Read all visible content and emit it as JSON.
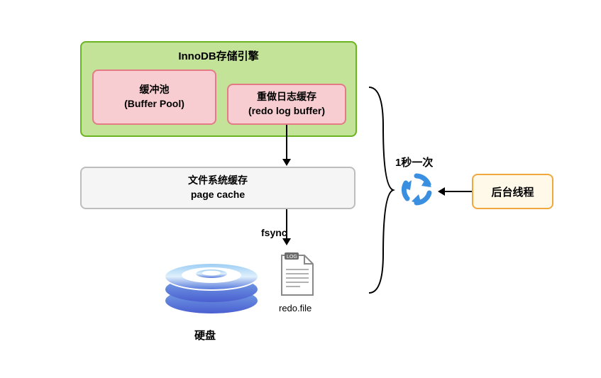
{
  "innodb": {
    "title": "InnoDB存储引擎"
  },
  "buffer_pool": {
    "line1": "缓冲池",
    "line2": "(Buffer Pool)"
  },
  "redo_buffer": {
    "line1": "重做日志缓存",
    "line2": "(redo log buffer)"
  },
  "page_cache": {
    "line1": "文件系统缓存",
    "line2": "page cache"
  },
  "bg_thread": {
    "label": "后台线程"
  },
  "labels": {
    "fsync": "fsync",
    "interval": "1秒一次",
    "disk": "硬盘",
    "redo_file": "redo.file"
  },
  "icons": {
    "disk": "disk-stack",
    "file": "log-file",
    "cycle": "refresh-cycle",
    "arrow": "arrow-down",
    "arrow_left": "arrow-left",
    "brace": "right-brace"
  }
}
